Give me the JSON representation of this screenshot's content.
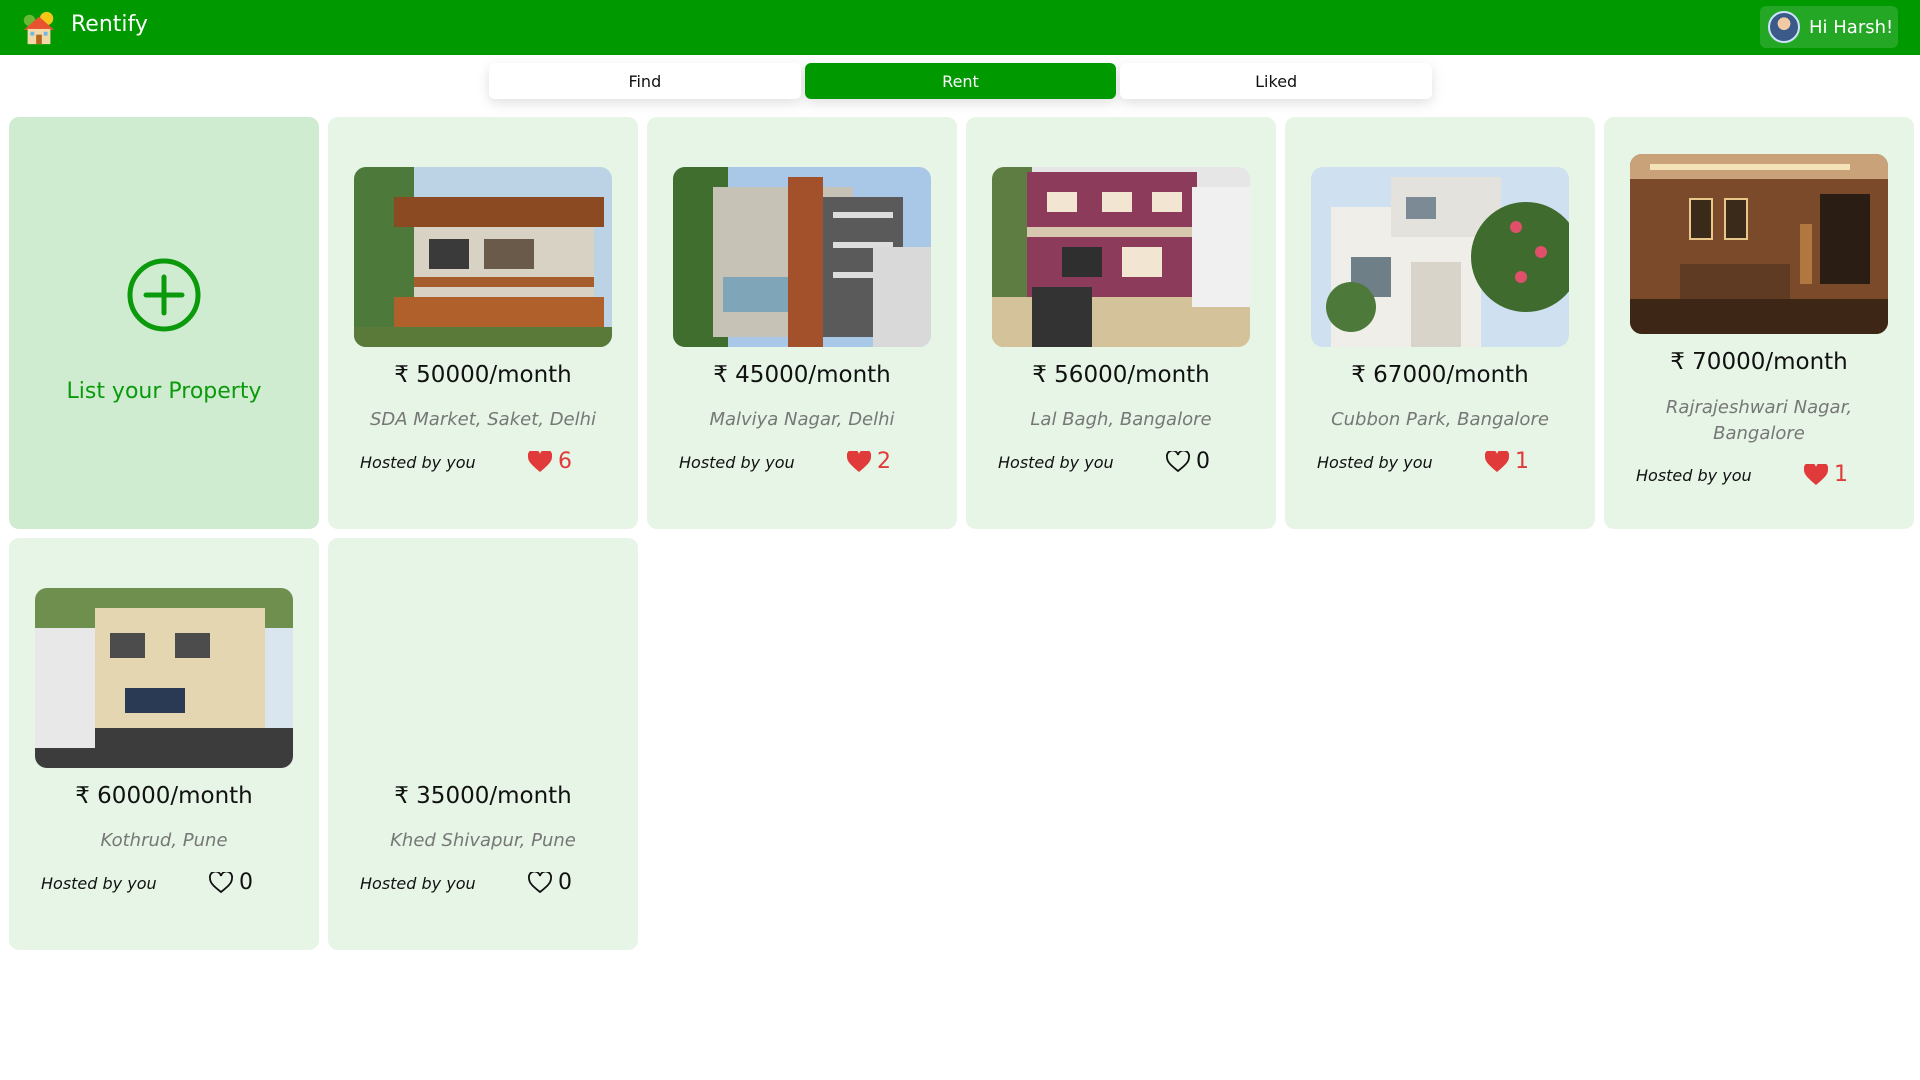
{
  "app": {
    "title": "Rentify"
  },
  "user": {
    "greeting": "Hi Harsh!"
  },
  "tabs": [
    {
      "label": "Find",
      "active": false
    },
    {
      "label": "Rent",
      "active": true
    },
    {
      "label": "Liked",
      "active": false
    }
  ],
  "add_property": {
    "label": "List your Property"
  },
  "listings": [
    {
      "price": "₹ 50000/month",
      "location": "SDA Market, Saket, Delhi",
      "host": "Hosted by you",
      "likes": "6",
      "liked": true
    },
    {
      "price": "₹ 45000/month",
      "location": "Malviya Nagar, Delhi",
      "host": "Hosted by you",
      "likes": "2",
      "liked": true
    },
    {
      "price": "₹ 56000/month",
      "location": "Lal Bagh, Bangalore",
      "host": "Hosted by you",
      "likes": "0",
      "liked": false
    },
    {
      "price": "₹ 67000/month",
      "location": "Cubbon Park, Bangalore",
      "host": "Hosted by you",
      "likes": "1",
      "liked": true
    },
    {
      "price": "₹ 70000/month",
      "location": "Rajrajeshwari Nagar, Bangalore",
      "host": "Hosted by you",
      "likes": "1",
      "liked": true
    },
    {
      "price": "₹ 60000/month",
      "location": "Kothrud, Pune",
      "host": "Hosted by you",
      "likes": "0",
      "liked": false
    },
    {
      "price": "₹ 35000/month",
      "location": "Khed Shivapur, Pune",
      "host": "Hosted by you",
      "likes": "0",
      "liked": false
    }
  ],
  "colors": {
    "brand": "#009900",
    "card": "#e6f5e6",
    "add_card": "#cfecd1",
    "like": "#e03a3a"
  }
}
